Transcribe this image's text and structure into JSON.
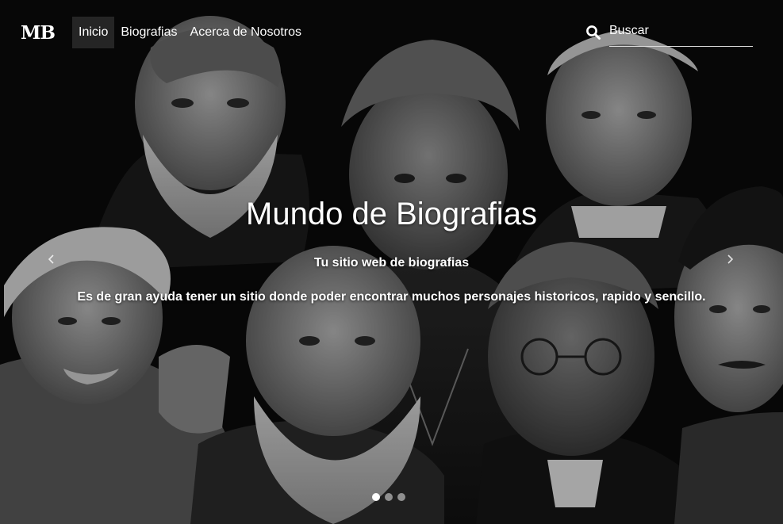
{
  "brand": {
    "logo_text": "MB"
  },
  "nav": {
    "items": [
      {
        "label": "Inicio",
        "active": true
      },
      {
        "label": "Biografias",
        "active": false
      },
      {
        "label": "Acerca de Nosotros",
        "active": false
      }
    ]
  },
  "search": {
    "placeholder": "Buscar",
    "value": ""
  },
  "hero": {
    "title": "Mundo de Biografias",
    "subtitle": "Tu sitio web de biografias",
    "description": "Es de gran ayuda tener un sitio donde poder encontrar muchos personajes historicos, rapido y sencillo."
  },
  "carousel": {
    "slide_count": 3,
    "active_index": 0,
    "prev_icon": "chevron-left-icon",
    "next_icon": "chevron-right-icon"
  },
  "colors": {
    "background": "#000000",
    "text": "#ffffff"
  }
}
